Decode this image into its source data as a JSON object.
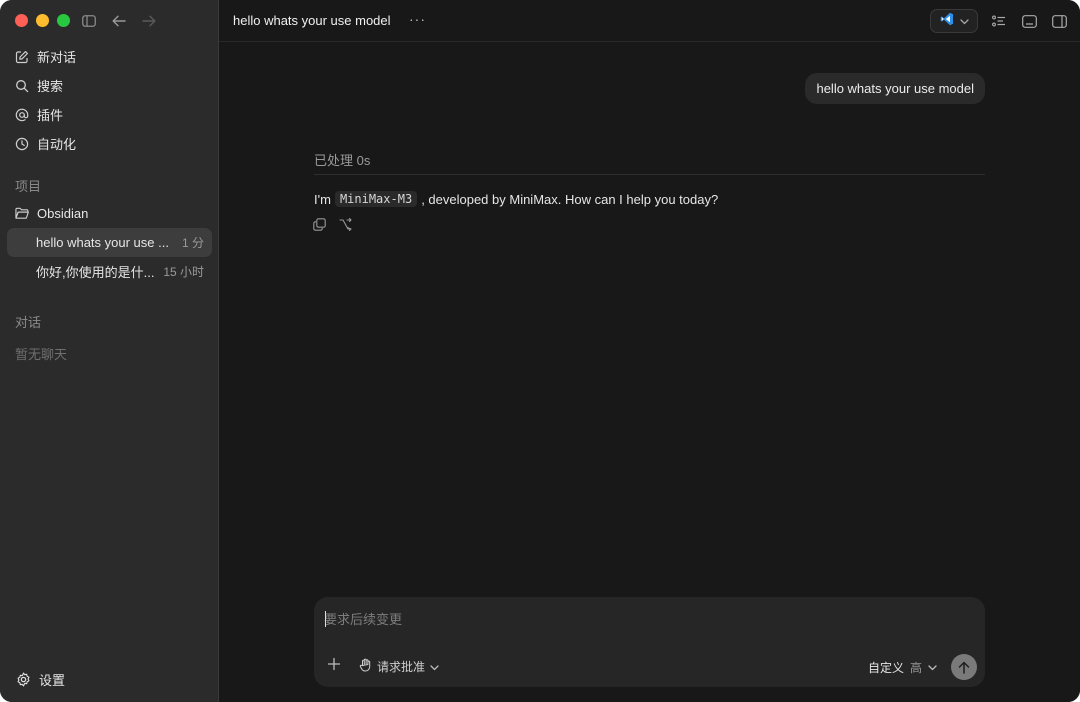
{
  "sidebar": {
    "nav": [
      {
        "label": "新对话",
        "icon": "edit-icon"
      },
      {
        "label": "搜索",
        "icon": "search-icon"
      },
      {
        "label": "插件",
        "icon": "at-icon"
      },
      {
        "label": "自动化",
        "icon": "clock-icon"
      }
    ],
    "projects_label": "项目",
    "project": {
      "name": "Obsidian",
      "icon": "folder-icon"
    },
    "threads": [
      {
        "title": "hello whats your use ...",
        "time": "1 分",
        "active": true
      },
      {
        "title": "你好,你使用的是什...",
        "time": "15 小时",
        "active": false
      }
    ],
    "conversations_label": "对话",
    "no_chats": "暂无聊天",
    "settings_label": "设置"
  },
  "header": {
    "title": "hello whats your use model",
    "more": "···"
  },
  "conversation": {
    "user_message": "hello whats your use model",
    "processed": "已处理 0s",
    "answer_prefix": "I'm",
    "answer_code": "MiniMax-M3",
    "answer_suffix": ", developed by MiniMax. How can I help you today?"
  },
  "composer": {
    "placeholder": "要求后续变更",
    "approval_label": "请求批准",
    "mode_label": "自定义",
    "level_label": "高"
  },
  "colors": {
    "sidebar_bg": "#2b2b2b",
    "main_bg": "#181818",
    "bubble_bg": "#262626",
    "vscode_blue": "#2f8ee8"
  }
}
